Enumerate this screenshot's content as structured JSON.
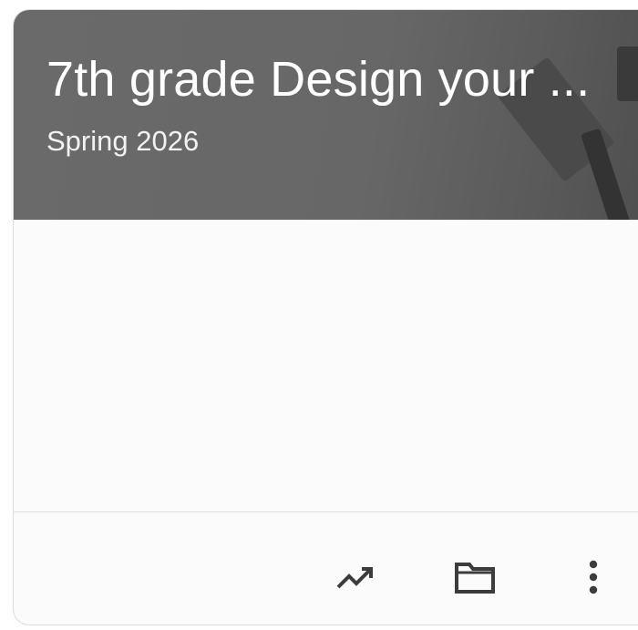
{
  "card": {
    "title": "7th grade Design your ...",
    "subtitle": "Spring 2026"
  },
  "actions": [
    {
      "icon": "trending-up-icon",
      "label": "Progress"
    },
    {
      "icon": "folder-icon",
      "label": "Folder"
    },
    {
      "icon": "more-vert-icon",
      "label": "More options"
    }
  ],
  "colors": {
    "header_bg": "#666666",
    "header_text": "#ffffff",
    "card_bg": "#fbfbfb",
    "icon": "#3c3c3c",
    "divider": "#dddddd"
  }
}
